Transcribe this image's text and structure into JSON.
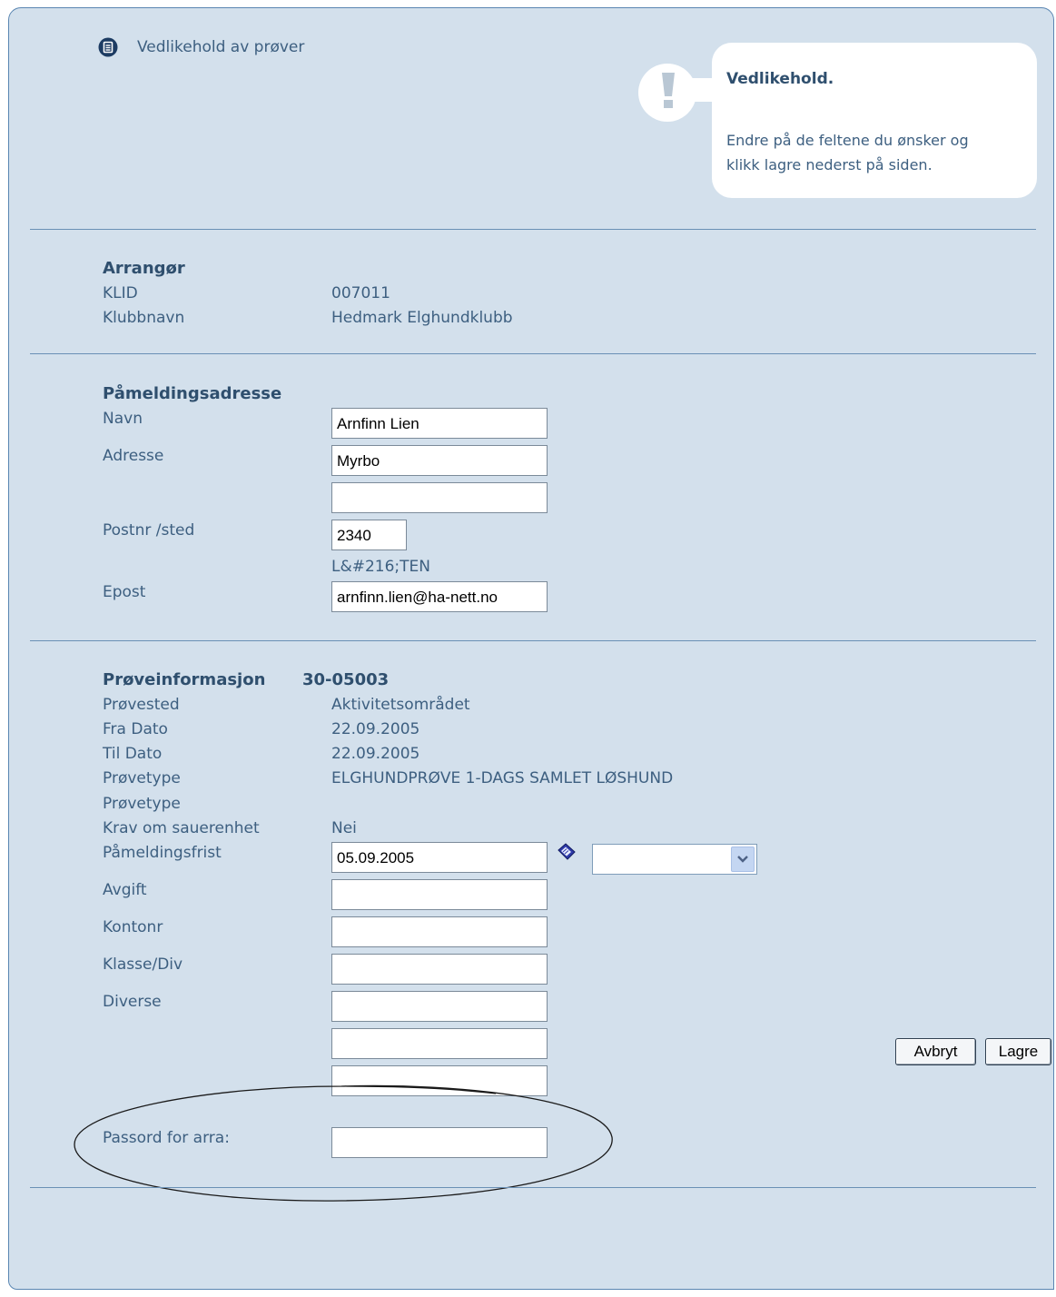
{
  "header": {
    "title": "Vedlikehold av prøver"
  },
  "info_box": {
    "title": "Vedlikehold.",
    "text_line1": "Endre på de feltene du ønsker og",
    "text_line2": "klikk lagre nederst på siden.",
    "icon_glyph": "!"
  },
  "arrangor": {
    "heading": "Arrangør",
    "klid_label": "KLID",
    "klid_value": "007011",
    "klubbnavn_label": "Klubbnavn",
    "klubbnavn_value": "Hedmark Elghundklubb"
  },
  "pamelding": {
    "heading": "Påmeldingsadresse",
    "navn_label": "Navn",
    "navn_value": "Arnfinn Lien",
    "adresse_label": "Adresse",
    "adresse_value": "Myrbo",
    "adresse2_value": "",
    "postnr_label": "Postnr /sted",
    "postnr_value": "2340",
    "sted_value": "L&#216;TEN",
    "epost_label": "Epost",
    "epost_value": "arnfinn.lien@ha-nett.no"
  },
  "proveinfo": {
    "heading": "Prøveinformasjon",
    "number": "30-05003",
    "provested_label": "Prøvested",
    "provested_value": "Aktivitetsområdet",
    "fradato_label": "Fra Dato",
    "fradato_value": "22.09.2005",
    "tildato_label": "Til Dato",
    "tildato_value": "22.09.2005",
    "provetype_label": "Prøvetype",
    "provetype_value": "ELGHUNDPRØVE 1-DAGS SAMLET LØSHUND",
    "provetype2_label": "Prøvetype",
    "krav_label": "Krav om sauerenhet",
    "krav_value": "Nei",
    "frist_label": "Påmeldingsfrist",
    "frist_value": "05.09.2005",
    "frist_select_value": "",
    "avgift_label": "Avgift",
    "avgift_value": "",
    "kontonr_label": "Kontonr",
    "kontonr_value": "",
    "klasse_label": "Klasse/Div",
    "klasse_value": "",
    "diverse_label": "Diverse",
    "diverse1_value": "",
    "diverse2_value": "",
    "diverse3_value": "",
    "passord_label": "Passord for arra:",
    "passord_value": ""
  },
  "buttons": {
    "cancel": "Avbryt",
    "save": "Lagre"
  },
  "colors": {
    "panel_bg": "#d3e0ec",
    "text": "#3d5f80",
    "divider": "#6a90b5"
  }
}
